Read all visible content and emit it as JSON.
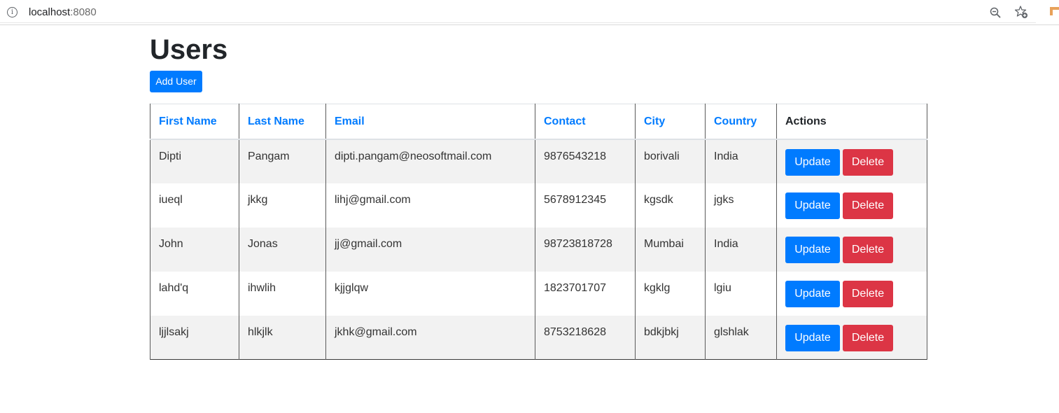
{
  "browser": {
    "url_host": "localhost",
    "url_port": ":8080"
  },
  "page": {
    "title": "Users",
    "add_user_label": "Add User"
  },
  "table": {
    "headers": [
      "First Name",
      "Last Name",
      "Email",
      "Contact",
      "City",
      "Country",
      "Actions"
    ],
    "rows": [
      [
        "Dipti",
        "Pangam",
        "dipti.pangam@neosoftmail.com",
        "9876543218",
        "borivali",
        "India"
      ],
      [
        "iueql",
        "jkkg",
        "lihj@gmail.com",
        "5678912345",
        "kgsdk",
        "jgks"
      ],
      [
        "John",
        "Jonas",
        "jj@gmail.com",
        "98723818728",
        "Mumbai",
        "India"
      ],
      [
        "lahd'q",
        "ihwlih",
        "kjjglqw",
        "1823701707",
        "kgklg",
        "lgiu"
      ],
      [
        "ljjlsakj",
        "hlkjlk",
        "jkhk@gmail.com",
        "8753218628",
        "bdkjbkj",
        "glshlak"
      ]
    ],
    "update_label": "Update",
    "delete_label": "Delete"
  },
  "colors": {
    "primary": "#007bff",
    "danger": "#dc3545",
    "stripe": "#f2f2f2"
  },
  "icons": [
    "info-icon",
    "zoom-icon",
    "star-add-icon",
    "extension-icon"
  ]
}
